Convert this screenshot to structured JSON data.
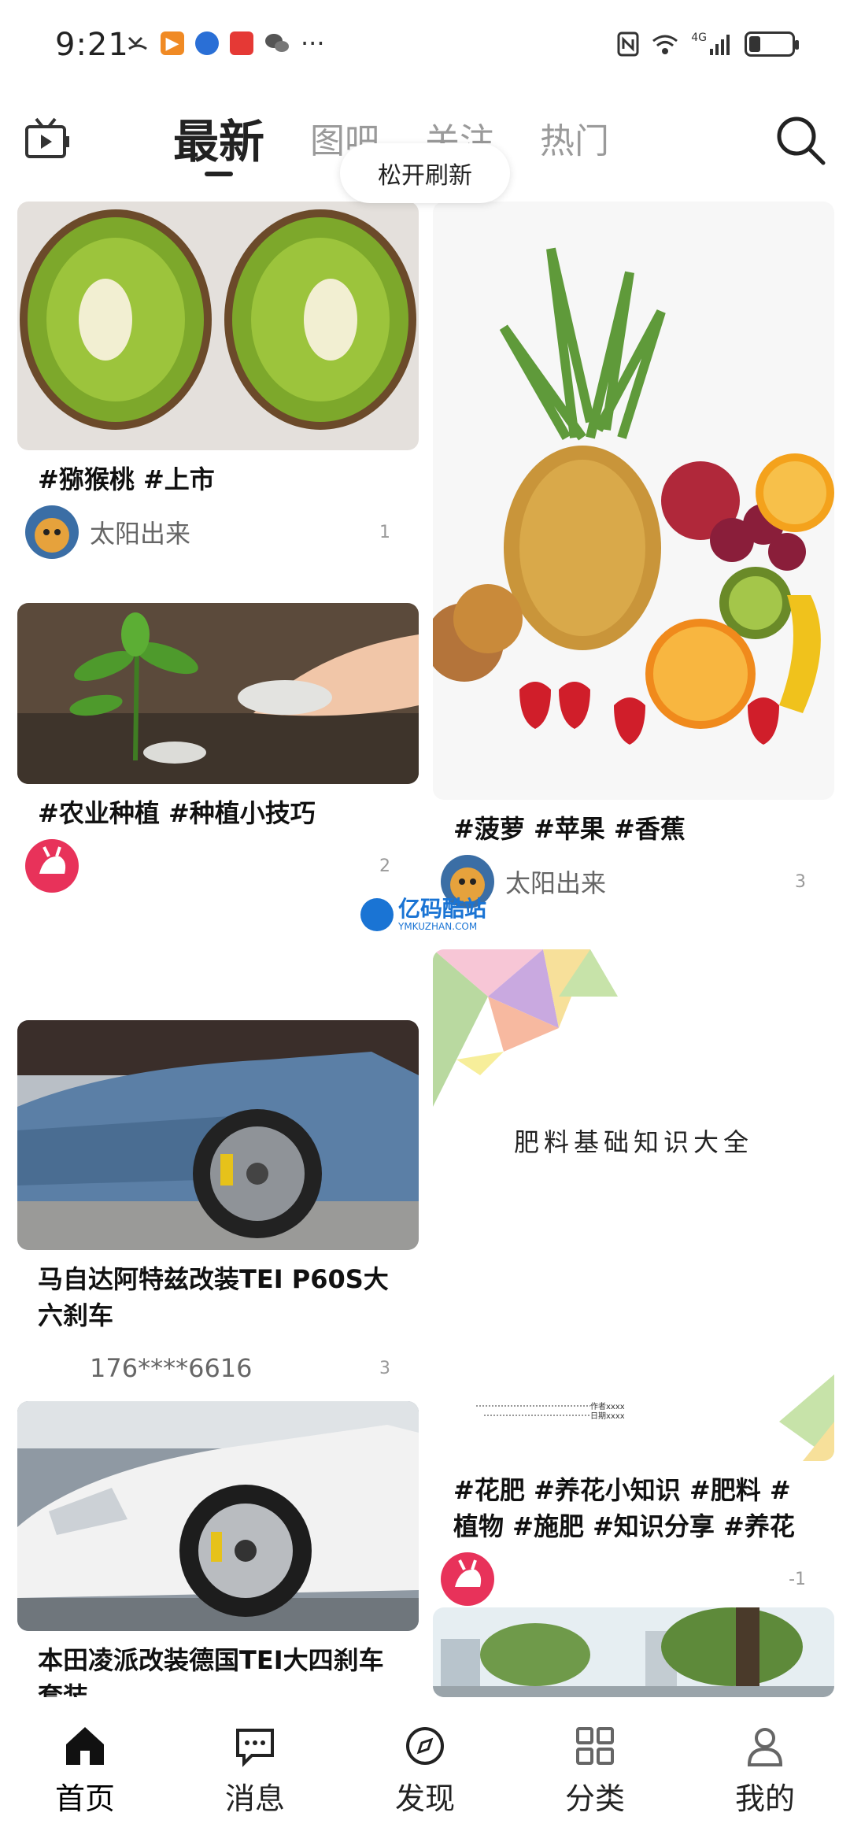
{
  "status_bar": {
    "time": "9:21",
    "dots": "···",
    "signal_label": "4G"
  },
  "header": {
    "tabs": [
      {
        "label": "最新"
      },
      {
        "label": "图吧"
      },
      {
        "label": "关注"
      },
      {
        "label": "热门"
      }
    ]
  },
  "refresh_hint": "松开刷新",
  "watermark": {
    "name": "亿码酷站",
    "domain": "YMKUZHAN.COM"
  },
  "feed": {
    "left": [
      {
        "title": "#猕猴桃 #上市",
        "author": "太阳出来",
        "count": "1"
      },
      {
        "title": "#农业种植 #种植小技巧",
        "author": "",
        "count": "2"
      },
      {
        "title": "马自达阿特兹改装TEI P60S大六刹车",
        "author": "176****6616",
        "count": "3"
      },
      {
        "title": "本田凌派改装德国TEI大四刹车套装",
        "author": "",
        "count": ""
      }
    ],
    "right": [
      {
        "title": "#菠萝 #苹果 #香蕉",
        "author": "太阳出来",
        "count": "3"
      },
      {
        "doc_title": "肥料基础知识大全",
        "doc_author_line": "作者xxxx",
        "doc_date_line": "日期xxxx",
        "title": "#花肥 #养花小知识 #肥料 #植物 #施肥 #知识分享 #养花 #肥",
        "author": "",
        "count": "-1"
      }
    ]
  },
  "bottom_nav": [
    {
      "label": "首页"
    },
    {
      "label": "消息"
    },
    {
      "label": "发现"
    },
    {
      "label": "分类"
    },
    {
      "label": "我的"
    }
  ]
}
